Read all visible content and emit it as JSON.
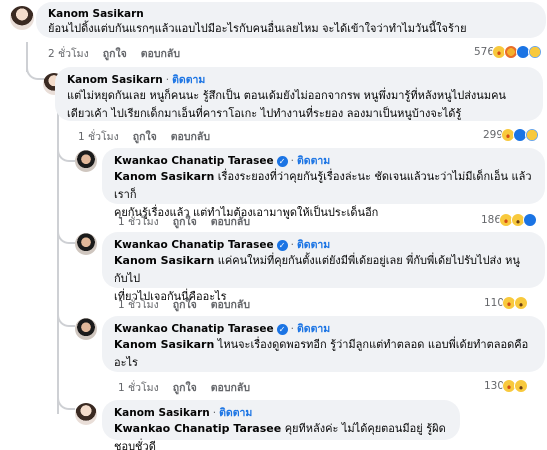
{
  "labels": {
    "follow": "ติดตาม",
    "like": "ถูกใจ",
    "reply": "ตอบกลับ",
    "dot": "·"
  },
  "comments": [
    {
      "author": "Kanom Sasikarn",
      "verified": false,
      "text": "ย้อนไปดิ้งแต่บกันแรกๆแล้วแอบไปมีอะไรกับคนอื่นเลยไหม จะได้เข้าใจว่าทำไมวันนี้ใจร้าย",
      "time": "2 ชั่วโมง",
      "reaction_count": "576",
      "reactions": [
        "haha-icon",
        "care-icon",
        "like-icon",
        "sad-icon"
      ]
    },
    {
      "author": "Kanom Sasikarn",
      "verified": false,
      "text_line1": "แต่ไม่หยุดกันเลย หนูก็คนนะ รู้สึกเป็น ตอนเด้มยังไม่ออกจากรพ หนูพึ่งมารู้ที่หลังหนูไปส่งนมคน",
      "text_line2": "เดียวเค้า ไปเรียกเด็กมาเอ็นที่คาราโอเกะ ไปทำงานที่ระยอง ลองมาเป็นหนูบ้างจะได้รู้",
      "time": "1 ชั่วโมง",
      "reaction_count": "299",
      "reactions": [
        "haha-icon",
        "like-icon",
        "sad-icon"
      ]
    },
    {
      "author": "Kwankao Chanatip Tarasee",
      "verified": true,
      "mention": "Kanom Sasikarn",
      "text_line1": " เรื่องระยองที่ว่าคุยกันรู้เรื่องล่ะนะ ชัดเจนแล้วนะว่าไม่มีเด็กเอ็น แล้วเราก็",
      "text_line2": "คุยกันรู้เรื่องแล้ว แต่ทำไมต้องเอามาพูดให้เป็นประเด็นอีก",
      "time": "1 ชั่วโมง",
      "reaction_count": "186",
      "reactions": [
        "haha-icon",
        "wow-icon",
        "like-icon"
      ]
    },
    {
      "author": "Kwankao Chanatip Tarasee",
      "verified": true,
      "mention": "Kanom Sasikarn",
      "text_line1": " แค่คนใหม่ที่คุยกันตั้งแต่ยังมีพี่เด้ยอยู่เลย พี่กับพี่เด้ยไปรับไปส่ง หนูกับไป",
      "text_line2": "เที่ยวไปเจอกันนี่คืออะไร",
      "time": "1 ชั่วโมง",
      "reaction_count": "110",
      "reactions": [
        "haha-icon",
        "wow-icon"
      ]
    },
    {
      "author": "Kwankao Chanatip Tarasee",
      "verified": true,
      "mention": "Kanom Sasikarn",
      "text_line1": " ไหนจะเรื่องดูดพอรทอีก รู้ว่ามีลูกแต่ทำตลอด แอบพี่เด้ยทำตลอดคือ",
      "text_line2": "อะไร",
      "time": "1 ชั่วโมง",
      "reaction_count": "130",
      "reactions": [
        "haha-icon",
        "wow-icon"
      ]
    },
    {
      "author": "Kanom Sasikarn",
      "verified": false,
      "mention": "Kwankao Chanatip Tarasee",
      "text_line1": " คุยทีหลังค่ะ ไม่ได้คุยตอนมีอยู่ รู้ผิดชอบชั่วดี"
    }
  ]
}
